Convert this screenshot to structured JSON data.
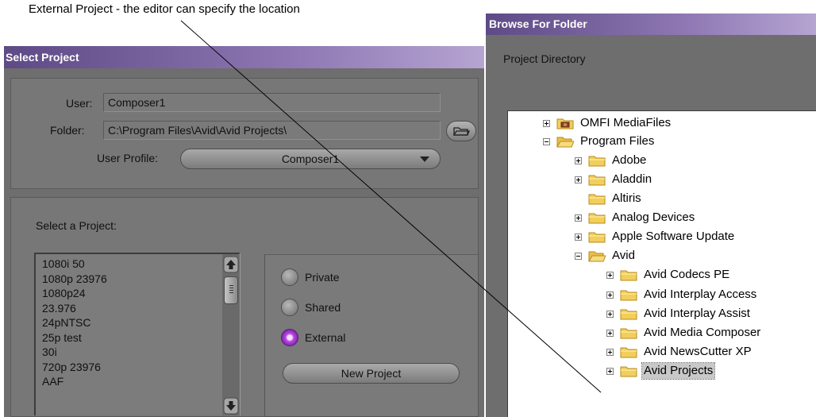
{
  "callout": {
    "text": "External Project - the editor can specify the location"
  },
  "select_project": {
    "title": "Select Project",
    "user_label": "User:",
    "user_value": "Composer1",
    "folder_label": "Folder:",
    "folder_value": "C:\\Program Files\\Avid\\Avid Projects\\",
    "profile_label": "User Profile:",
    "profile_value": "Composer1",
    "select_label": "Select a Project:",
    "projects": [
      "1080i 50",
      "1080p 23976",
      "1080p24",
      "23.976",
      "24pNTSC",
      "25p test",
      "30i",
      "720p 23976",
      "AAF"
    ],
    "radio_private": "Private",
    "radio_shared": "Shared",
    "radio_external": "External",
    "selected_radio": "External",
    "new_project_button": "New Project"
  },
  "browse": {
    "title": "Browse For Folder",
    "caption": "Project Directory",
    "tree": [
      {
        "label": "OMFI MediaFiles",
        "expander": "plus",
        "icon": "folder-media-icon"
      },
      {
        "label": "Program Files",
        "expander": "minus",
        "icon": "folder-open-icon"
      },
      {
        "label": "Adobe",
        "expander": "plus",
        "icon": "folder-icon"
      },
      {
        "label": "Aladdin",
        "expander": "plus",
        "icon": "folder-icon"
      },
      {
        "label": "Altiris",
        "expander": "none",
        "icon": "folder-icon"
      },
      {
        "label": "Analog Devices",
        "expander": "plus",
        "icon": "folder-icon"
      },
      {
        "label": "Apple Software Update",
        "expander": "plus",
        "icon": "folder-icon"
      },
      {
        "label": "Avid",
        "expander": "minus",
        "icon": "folder-open-icon"
      },
      {
        "label": "Avid Codecs PE",
        "expander": "plus",
        "icon": "folder-icon"
      },
      {
        "label": "Avid Interplay Access",
        "expander": "plus",
        "icon": "folder-icon"
      },
      {
        "label": "Avid Interplay Assist",
        "expander": "plus",
        "icon": "folder-icon"
      },
      {
        "label": "Avid Media Composer",
        "expander": "plus",
        "icon": "folder-icon"
      },
      {
        "label": "Avid NewsCutter XP",
        "expander": "plus",
        "icon": "folder-icon"
      },
      {
        "label": "Avid Projects",
        "expander": "plus",
        "icon": "folder-icon"
      }
    ],
    "selected_item": "Avid Projects"
  },
  "colors": {
    "titlebar": "#8e77b3",
    "panel": "#777777",
    "radio_selected": "#b84be0",
    "folder_yellow": "#f2cf5a"
  }
}
